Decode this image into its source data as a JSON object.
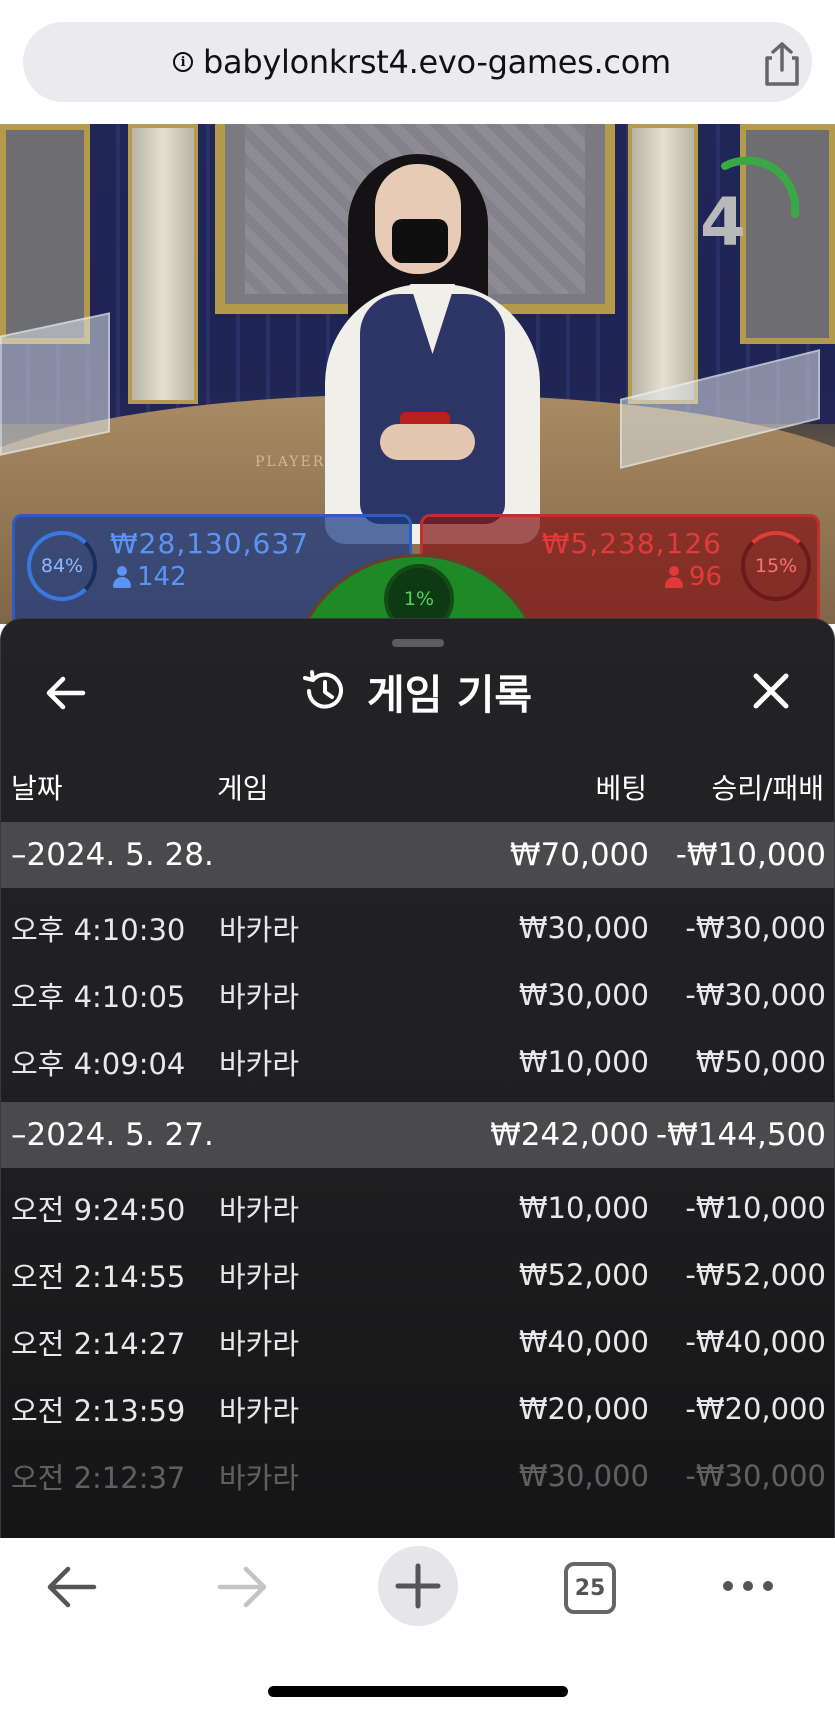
{
  "browser": {
    "url": "babylonkrst4.evo-games.com",
    "tab_count": "25"
  },
  "video": {
    "table_text": "PLAYER       BANKER",
    "countdown": "4",
    "player": {
      "percent": "84%",
      "amount": "₩28,130,637",
      "count": "142",
      "color": "#2c5ec0"
    },
    "banker": {
      "percent": "15%",
      "amount": "₩5,238,126",
      "count": "96",
      "color": "#c03030"
    },
    "tie": {
      "percent": "1%",
      "color": "#1e8a26"
    }
  },
  "sheet": {
    "title": "게임 기록",
    "columns": {
      "date": "날짜",
      "game": "게임",
      "bet": "베팅",
      "winloss": "승리/패배"
    },
    "groups": [
      {
        "date": "–2024. 5. 28.",
        "bet": "₩70,000",
        "winloss": "-₩10,000",
        "rows": [
          {
            "time": "오후 4:10:30",
            "game": "바카라",
            "bet": "₩30,000",
            "winloss": "-₩30,000"
          },
          {
            "time": "오후 4:10:05",
            "game": "바카라",
            "bet": "₩30,000",
            "winloss": "-₩30,000"
          },
          {
            "time": "오후 4:09:04",
            "game": "바카라",
            "bet": "₩10,000",
            "winloss": "₩50,000"
          }
        ]
      },
      {
        "date": "–2024. 5. 27.",
        "bet": "₩242,000",
        "winloss": "-₩144,500",
        "rows": [
          {
            "time": "오전 9:24:50",
            "game": "바카라",
            "bet": "₩10,000",
            "winloss": "-₩10,000"
          },
          {
            "time": "오전 2:14:55",
            "game": "바카라",
            "bet": "₩52,000",
            "winloss": "-₩52,000"
          },
          {
            "time": "오전 2:14:27",
            "game": "바카라",
            "bet": "₩40,000",
            "winloss": "-₩40,000"
          },
          {
            "time": "오전 2:13:59",
            "game": "바카라",
            "bet": "₩20,000",
            "winloss": "-₩20,000"
          },
          {
            "time": "오전 2:12:37",
            "game": "바카라",
            "bet": "₩30,000",
            "winloss": "-₩30,000"
          }
        ]
      }
    ]
  },
  "icons": {
    "info": "info-icon",
    "share": "share-icon",
    "back": "arrow-left-icon",
    "history": "history-icon",
    "close": "close-icon",
    "nav_back": "arrow-left-icon",
    "nav_forward": "arrow-right-icon",
    "new_tab": "plus-icon",
    "tabs": "tabs-icon",
    "more": "more-icon"
  }
}
